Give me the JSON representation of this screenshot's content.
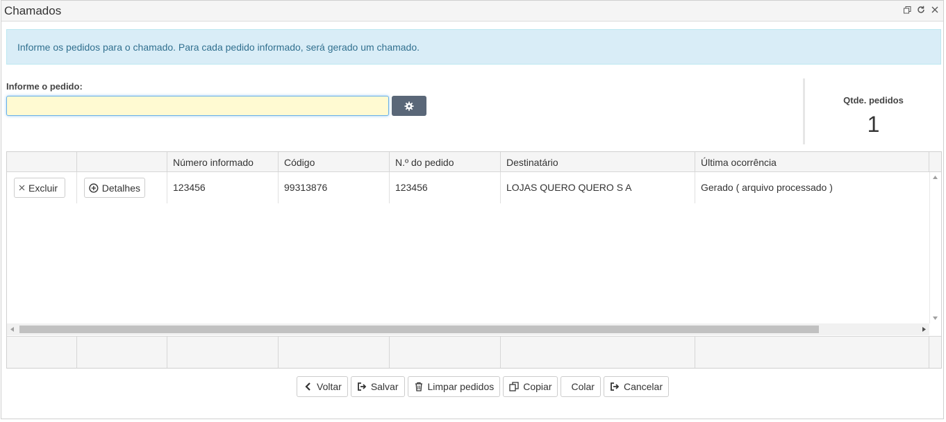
{
  "window": {
    "title": "Chamados"
  },
  "alert": {
    "text": "Informe os pedidos para o chamado. Para cada pedido informado, será gerado um chamado."
  },
  "form": {
    "label": "Informe o pedido:",
    "value": "",
    "placeholder": ""
  },
  "summary": {
    "label": "Qtde. pedidos",
    "value": "1"
  },
  "table": {
    "columns": [
      "",
      "",
      "Número informado",
      "Código",
      "N.º do pedido",
      "Destinatário",
      "Última ocorrência"
    ],
    "rows": [
      {
        "delete_label": "Excluir",
        "details_label": "Detalhes",
        "numero_informado": "123456",
        "codigo": "99313876",
        "numero_pedido": "123456",
        "destinatario": "LOJAS QUERO QUERO S A",
        "ultima_ocorrencia": "Gerado ( arquivo processado )"
      }
    ]
  },
  "actions": {
    "voltar": "Voltar",
    "salvar": "Salvar",
    "limpar": "Limpar pedidos",
    "copiar": "Copiar",
    "colar": "Colar",
    "cancelar": "Cancelar"
  },
  "icons": {
    "restore": "restore-window-icon",
    "refresh": "refresh-icon",
    "close": "close-icon",
    "settings": "gear-icon"
  },
  "colors": {
    "alert_bg": "#d9edf7",
    "alert_text": "#31708f",
    "input_bg": "#fffad2",
    "gear_button_bg": "#5a6778"
  }
}
